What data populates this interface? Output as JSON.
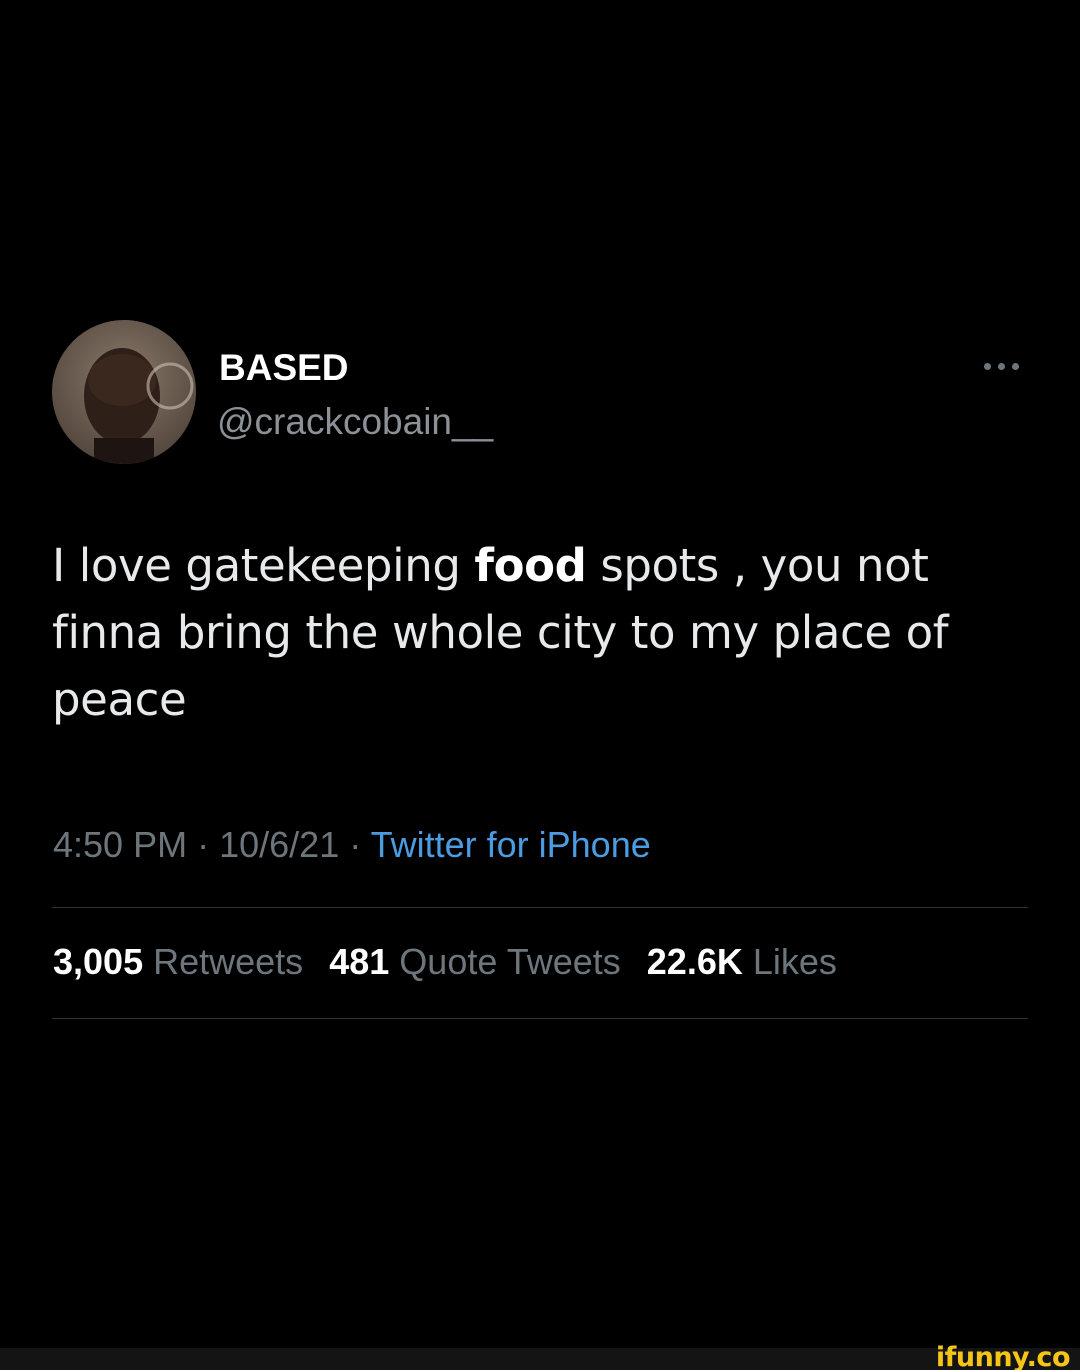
{
  "tweet": {
    "display_name": "BASED",
    "handle": "@crackcobain__",
    "text_before": "I love gatekeeping ",
    "text_bold": "food",
    "text_after": " spots , you not finna bring the whole city to my place of peace",
    "time": "4:50 PM",
    "separator": "·",
    "date": "10/6/21",
    "source": "Twitter for iPhone",
    "icons": {
      "avatar": "profile-photo",
      "more": "more-options-icon"
    },
    "stats": {
      "retweets": {
        "count": "3,005",
        "label": "Retweets"
      },
      "quotes": {
        "count": "481",
        "label": "Quote Tweets"
      },
      "likes": {
        "count": "22.6K",
        "label": "Likes"
      }
    }
  },
  "watermark": "ifunny.co",
  "colors": {
    "background": "#000000",
    "text": "#e7e9ea",
    "muted": "#6e767d",
    "link": "#4b9ce0",
    "divider": "#2f3336",
    "watermark": "#f5c518"
  }
}
